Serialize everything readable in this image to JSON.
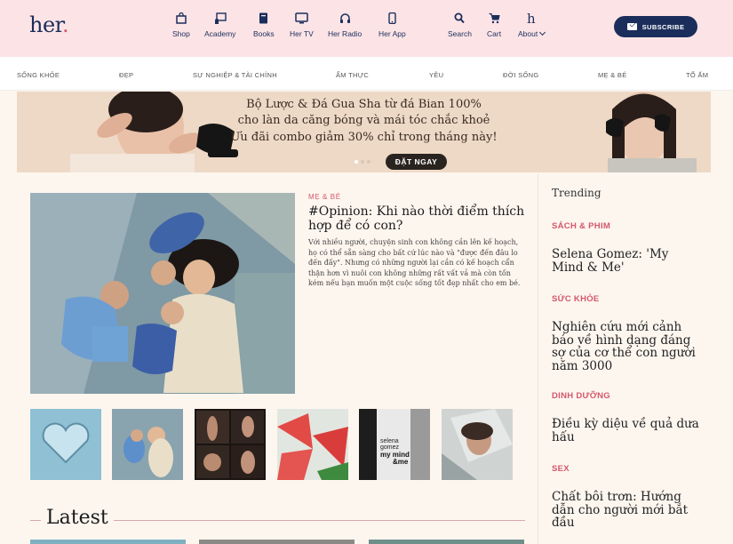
{
  "header": {
    "logo": "her",
    "nav": [
      {
        "label": "Shop",
        "icon": "shop-bag-icon"
      },
      {
        "label": "Academy",
        "icon": "academy-board-icon"
      },
      {
        "label": "Books",
        "icon": "book-icon"
      },
      {
        "label": "Her TV",
        "icon": "tv-icon"
      },
      {
        "label": "Her Radio",
        "icon": "headphones-icon"
      },
      {
        "label": "Her App",
        "icon": "phone-icon"
      },
      {
        "label": "Search",
        "icon": "search-icon"
      },
      {
        "label": "Cart",
        "icon": "cart-icon"
      },
      {
        "label": "About",
        "icon": "h-logo-icon"
      }
    ],
    "subscribe": "SUBSCRIBE"
  },
  "categories": [
    "SỐNG KHỎE",
    "ĐẸP",
    "SỰ NGHIỆP & TÀI CHÍNH",
    "ẨM THỰC",
    "YÊU",
    "ĐỜI SỐNG",
    "MẸ & BÉ",
    "TỔ ẤM"
  ],
  "banner": {
    "lines": [
      "Bộ Lược & Đá Gua Sha từ đá Bian 100%",
      "cho làn da căng bóng và mái tóc chắc khoẻ",
      "Ưu đãi combo giảm 30% chỉ trong tháng này!"
    ],
    "cta": "ĐẶT NGAY"
  },
  "feature": {
    "category": "MẸ & BÉ",
    "title": "#Opinion: Khi nào thời điểm thích hợp để có con?",
    "description": "Với nhiều người, chuyện sinh con không cần lên kế hoạch, họ có thể sẵn sàng cho bất cứ lúc nào và \"được đến đâu lo đến đấy\". Nhưng có những người lại cần có kế hoạch cẩn thận hơn vì nuôi con không những rất vất vả mà còn tốn kém nếu bạn muốn một cuộc sống tốt đẹp nhất cho em bé."
  },
  "thumbnails": [
    "glass-heart-thumb",
    "family-thumb",
    "body-grid-thumb",
    "watermelon-thumb",
    "selena-gomez-thumb",
    "mirror-woman-thumb"
  ],
  "trending": {
    "heading": "Trending",
    "items": [
      {
        "category": "SÁCH & PHIM",
        "title": "Selena Gomez: 'My Mind & Me'"
      },
      {
        "category": "SỨC KHỎE",
        "title": "Nghiên cứu mới cảnh báo về hình dạng đáng sợ của cơ thể con người năm 3000"
      },
      {
        "category": "DINH DƯỠNG",
        "title": "Điều kỳ diệu về quả dưa hấu"
      },
      {
        "category": "SEX",
        "title": "Chất bôi trơn: Hướng dẫn cho người mới bắt đầu"
      }
    ]
  },
  "latest": {
    "heading": "Latest"
  },
  "colors": {
    "navy": "#1b2d5b",
    "pink": "#fce4e6",
    "accent": "#d4576b",
    "cream": "#fdf6ef"
  }
}
